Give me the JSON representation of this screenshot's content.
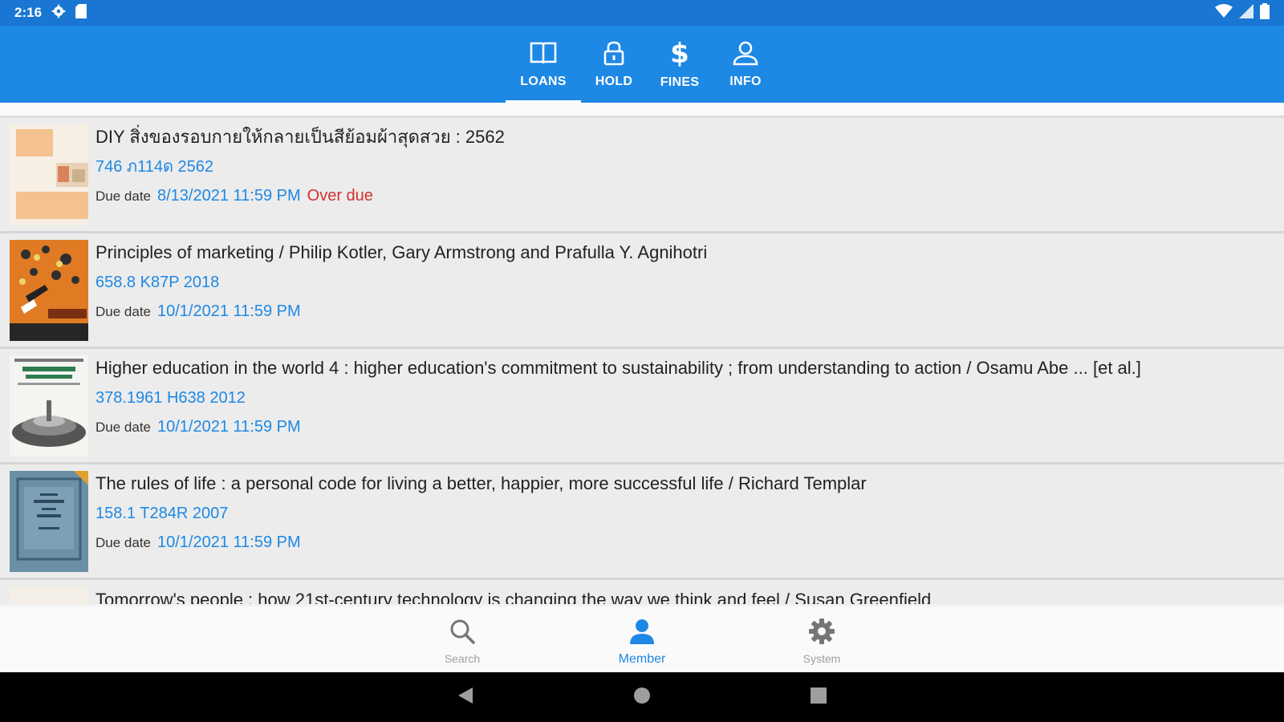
{
  "status_bar": {
    "time": "2:16",
    "icons": [
      "gear-icon",
      "sd-card-icon",
      "wifi-icon",
      "signal-icon",
      "battery-icon"
    ]
  },
  "tabs": [
    {
      "id": "loans",
      "label": "LOANS",
      "icon": "book-icon",
      "active": true
    },
    {
      "id": "hold",
      "label": "HOLD",
      "icon": "lock-icon",
      "active": false
    },
    {
      "id": "fines",
      "label": "FINES",
      "icon": "dollar-icon",
      "active": false
    },
    {
      "id": "info",
      "label": "INFO",
      "icon": "person-icon",
      "active": false
    }
  ],
  "loans": [
    {
      "title": "DIY สิ่งของรอบกายให้กลายเป็นสีย้อมผ้าสุดสวย : 2562",
      "call_number": "746 ภ114ด 2562",
      "due_label": "Due date",
      "due_date": "8/13/2021 11:59 PM",
      "status": "Over due"
    },
    {
      "title": "Principles of marketing /  Philip Kotler, Gary Armstrong and Prafulla Y. Agnihotri",
      "call_number": "658.8 K87P 2018",
      "due_label": "Due date",
      "due_date": "10/1/2021 11:59 PM",
      "status": ""
    },
    {
      "title": "Higher education in the world 4 :  higher education's commitment to sustainability ; from understanding to action /  Osamu Abe ... [et al.]",
      "call_number": "378.1961 H638 2012",
      "due_label": "Due date",
      "due_date": "10/1/2021 11:59 PM",
      "status": ""
    },
    {
      "title": "The rules of life :  a personal code for living a better, happier, more successful life /  Richard Templar",
      "call_number": "158.1 T284R 2007",
      "due_label": "Due date",
      "due_date": "10/1/2021 11:59 PM",
      "status": ""
    }
  ],
  "partial_item": {
    "title": "Tomorrow's people : how 21st-century technology is changing the way we think and feel /  Susan Greenfield"
  },
  "bottom_nav": [
    {
      "id": "search",
      "label": "Search",
      "icon": "search-icon",
      "active": false
    },
    {
      "id": "member",
      "label": "Member",
      "icon": "person-icon",
      "active": true
    },
    {
      "id": "system",
      "label": "System",
      "icon": "gear-icon",
      "active": false
    }
  ],
  "colors": {
    "status_bar": "#1976d2",
    "app_bar": "#1e88e5",
    "accent": "#1e88e5",
    "overdue": "#d32f2f"
  }
}
